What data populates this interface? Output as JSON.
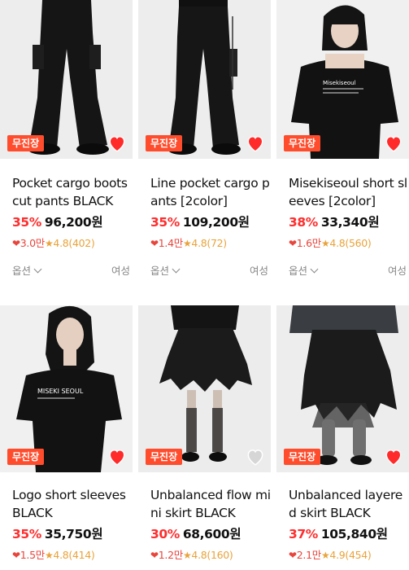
{
  "colors": {
    "badge": "#ff4c2c",
    "discount": "#ff2d2d",
    "likes": "#e8453c",
    "rating": "#e9a33a",
    "heart_active": "#ff2a2a"
  },
  "products": [
    {
      "badge": "무진장",
      "title": "Pocket cargo boots cut pants BLACK",
      "discount": "35%",
      "price": "96,200원",
      "likes": "3.0만",
      "rating": "4.8(402)",
      "option_label": "옵션",
      "gender": "여성",
      "liked": true
    },
    {
      "badge": "무진장",
      "title": "Line pocket cargo pants [2color]",
      "discount": "35%",
      "price": "109,200원",
      "likes": "1.4만",
      "rating": "4.8(72)",
      "option_label": "옵션",
      "gender": "여성",
      "liked": true
    },
    {
      "badge": "무진장",
      "title": "Misekiseoul short sleeves [2color]",
      "discount": "38%",
      "price": "33,340원",
      "likes": "1.6만",
      "rating": "4.8(560)",
      "option_label": "옵션",
      "gender": "여성",
      "liked": true,
      "shirt_text": "Misekiseoul"
    },
    {
      "badge": "무진장",
      "title": "Logo short sleeves BLACK",
      "discount": "35%",
      "price": "35,750원",
      "likes": "1.5만",
      "rating": "4.8(414)",
      "liked": true,
      "shirt_text": "MISEKI SEOUL"
    },
    {
      "badge": "무진장",
      "title": "Unbalanced flow mini skirt BLACK",
      "discount": "30%",
      "price": "68,600원",
      "likes": "1.2만",
      "rating": "4.8(160)",
      "liked": false
    },
    {
      "badge": "무진장",
      "title": "Unbalanced layered skirt BLACK",
      "discount": "37%",
      "price": "105,840원",
      "likes": "2.1만",
      "rating": "4.9(454)",
      "liked": true
    }
  ]
}
